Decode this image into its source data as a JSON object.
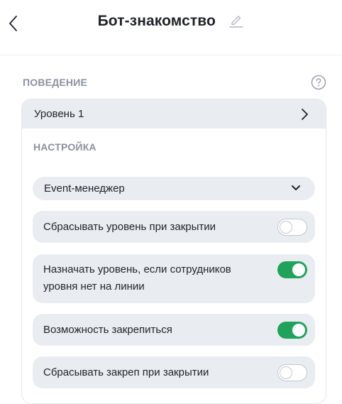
{
  "header": {
    "title": "Бот-знакомство",
    "back_icon": "chevron-left-icon",
    "edit_icon": "pencil-icon"
  },
  "behavior": {
    "section_label": "ПОВЕДЕНИЕ",
    "help_icon": "question-circle-icon",
    "level": {
      "label": "Уровень 1",
      "icon": "chevron-right-icon"
    },
    "settings": {
      "section_label": "НАСТРОЙКА",
      "role_select": {
        "value": "Event-менеджер",
        "icon": "chevron-down-icon"
      },
      "options": [
        {
          "label": "Сбрасывать уровень при закрытии",
          "enabled": false
        },
        {
          "label_line1": "Назначать уровень, если сотрудников",
          "label_line2": "уровня нет на линии",
          "enabled": true
        },
        {
          "label": "Возможность закрепиться",
          "enabled": true
        },
        {
          "label": "Сбрасывать закреп при закрытии",
          "enabled": false
        }
      ]
    }
  },
  "colors": {
    "accent_green": "#1fa35a",
    "row_background": "#e9edf2",
    "muted_label": "#8a929e"
  }
}
